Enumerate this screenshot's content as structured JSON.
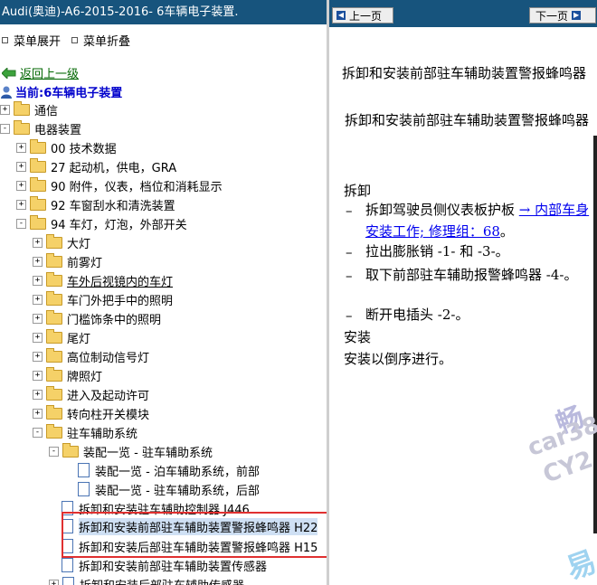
{
  "left": {
    "title": "Audi(奥迪)-A6-2015-2016- 6车辆电子装置.",
    "menu_expand": "菜单展开",
    "menu_collapse": "菜单折叠",
    "back": "返回上一级",
    "current": "当前:6车辆电子装置",
    "tree": [
      {
        "label": "通信",
        "toggle": "+"
      },
      {
        "label": "电器装置",
        "toggle": "-"
      },
      {
        "label": "00 技术数据",
        "toggle": "+"
      },
      {
        "label": "27 起动机，供电，GRA",
        "toggle": "+"
      },
      {
        "label": "90 附件，仪表，档位和消耗显示",
        "toggle": "+"
      },
      {
        "label": "92 车窗刮水和清洗装置",
        "toggle": "+"
      },
      {
        "label": "94 车灯，灯泡，外部开关",
        "toggle": "-"
      },
      {
        "label": "大灯",
        "toggle": "+"
      },
      {
        "label": "前雾灯",
        "toggle": "+"
      },
      {
        "label": "车外后视镜内的车灯",
        "toggle": "+"
      },
      {
        "label": "车门外把手中的照明",
        "toggle": "+"
      },
      {
        "label": "门槛饰条中的照明",
        "toggle": "+"
      },
      {
        "label": "尾灯",
        "toggle": "+"
      },
      {
        "label": "高位制动信号灯",
        "toggle": "+"
      },
      {
        "label": "牌照灯",
        "toggle": "+"
      },
      {
        "label": "进入及起动许可",
        "toggle": "+"
      },
      {
        "label": "转向柱开关模块",
        "toggle": "+"
      },
      {
        "label": "驻车辅助系统",
        "toggle": "-"
      },
      {
        "label": "装配一览 - 驻车辅助系统",
        "toggle": "-"
      },
      {
        "label": "装配一览 - 泊车辅助系统，前部"
      },
      {
        "label": "装配一览 - 驻车辅助系统，后部"
      },
      {
        "label": "拆卸和安装驻车辅助控制器 J446"
      },
      {
        "label": "拆卸和安装前部驻车辅助装置警报蜂鸣器 H22"
      },
      {
        "label": "拆卸和安装后部驻车辅助装置警报蜂鸣器 H15"
      },
      {
        "label": "拆卸和安装前部驻车辅助装置传感器"
      },
      {
        "label": "拆卸和安装后部驻车辅助传感器"
      }
    ]
  },
  "right": {
    "prev_label": "上一页",
    "next_label": "下一页",
    "heading1": "拆卸和安装前部驻车辅助装置警报蜂鸣器",
    "heading2": "拆卸和安装前部驻车辅助装置警报蜂鸣器",
    "remove_title": "拆卸",
    "steps": [
      {
        "text": "拆卸驾驶员侧仪表板护板 ",
        "link": "→ 内部车身安装工作; 修理组：68",
        "after": "。"
      },
      {
        "text": "拉出膨胀销 -1- 和 -3-。"
      },
      {
        "text": "取下前部驻车辅助报警蜂鸣器 -4-。"
      },
      {
        "text": "断开电插头 -2-。"
      }
    ],
    "install_title": "安装",
    "install_text": "安装以倒序进行。",
    "watermark": [
      "畅",
      "car38",
      "CY2",
      "易"
    ]
  },
  "colors": {
    "header": "#17547d",
    "highlight_border": "#e03030",
    "link": "#0000ee"
  }
}
